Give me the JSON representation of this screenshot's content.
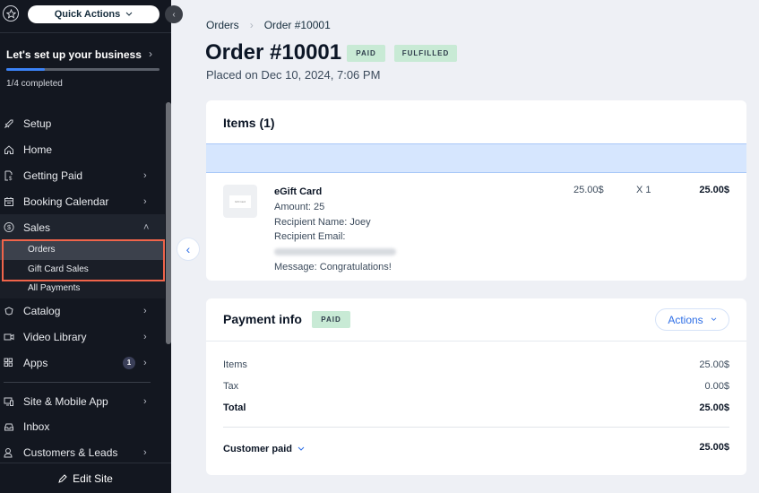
{
  "sidebar": {
    "quick_actions_label": "Quick Actions",
    "setup": {
      "title": "Let's set up your business",
      "progress_fraction": 0.25,
      "subtitle": "1/4 completed"
    },
    "items": [
      {
        "label": "Setup",
        "icon": "rocket-icon"
      },
      {
        "label": "Home",
        "icon": "home-icon"
      },
      {
        "label": "Getting Paid",
        "icon": "invoice-icon",
        "chevron": "›"
      },
      {
        "label": "Booking Calendar",
        "icon": "calendar-icon",
        "chevron": "›"
      },
      {
        "label": "Sales",
        "icon": "dollar-icon",
        "chevron": "˄"
      },
      {
        "label": "Catalog",
        "icon": "catalog-icon",
        "chevron": "›"
      },
      {
        "label": "Video Library",
        "icon": "video-icon",
        "chevron": "›"
      },
      {
        "label": "Apps",
        "icon": "apps-icon",
        "badge": "1",
        "chevron": "›"
      },
      {
        "label": "Site & Mobile App",
        "icon": "devices-icon",
        "chevron": "›"
      },
      {
        "label": "Inbox",
        "icon": "inbox-icon"
      },
      {
        "label": "Customers & Leads",
        "icon": "people-icon",
        "chevron": "›"
      }
    ],
    "sales_sub": [
      {
        "label": "Orders"
      },
      {
        "label": "Gift Card Sales"
      },
      {
        "label": "All Payments"
      }
    ],
    "edit_site_label": "Edit Site"
  },
  "breadcrumb": {
    "parent": "Orders",
    "separator": "›",
    "current": "Order #10001"
  },
  "order": {
    "title": "Order #10001",
    "tags": [
      "PAID",
      "FULFILLED"
    ],
    "placed": "Placed on Dec 10, 2024, 7:06 PM"
  },
  "items_card": {
    "title": "Items (1)",
    "items": [
      {
        "thumb_text": "Gift Card",
        "name": "eGift Card",
        "lines": [
          "Amount: 25",
          "Recipient Name: Joey",
          "Recipient Email:"
        ],
        "message": "Message: Congratulations!",
        "price": "25.00$",
        "qty": "X 1",
        "total": "25.00$"
      }
    ]
  },
  "payment": {
    "title": "Payment info",
    "tag": "PAID",
    "actions_label": "Actions",
    "rows": [
      {
        "label": "Items",
        "value": "25.00$"
      },
      {
        "label": "Tax",
        "value": "0.00$"
      },
      {
        "label": "Total",
        "value": "25.00$"
      }
    ],
    "customer_paid_label": "Customer paid",
    "customer_paid_value": "25.00$"
  },
  "colors": {
    "sidebar_bg": "#131720",
    "accent": "#2f6fe6",
    "tag_bg": "#c8ead5",
    "highlight": "#f0644a"
  }
}
